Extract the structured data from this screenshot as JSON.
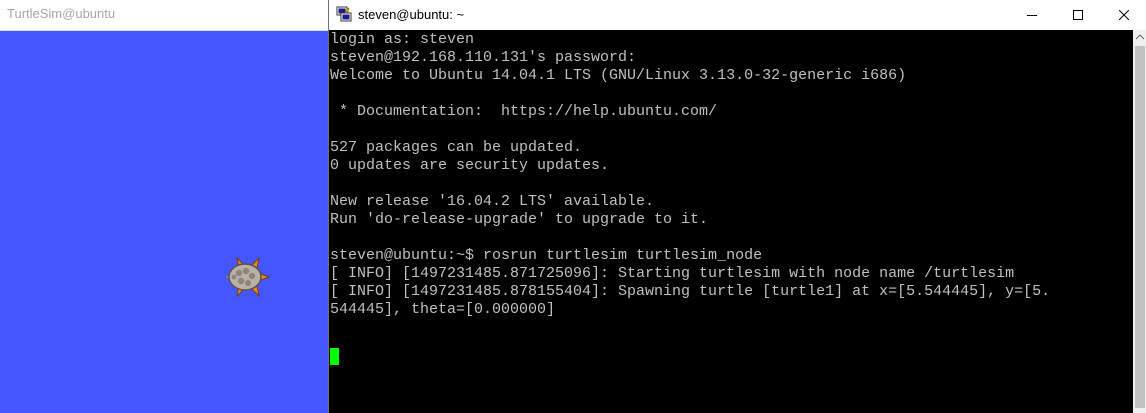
{
  "turtlesim": {
    "title": "TurtleSim@ubuntu",
    "background_color": "#4556ff"
  },
  "terminal": {
    "title": "steven@ubuntu: ~",
    "icons": {
      "app": "putty-icon",
      "minimize": "minimize-icon",
      "maximize": "maximize-icon",
      "close": "close-icon"
    },
    "lines": [
      "login as: steven",
      "steven@192.168.110.131's password:",
      "Welcome to Ubuntu 14.04.1 LTS (GNU/Linux 3.13.0-32-generic i686)",
      "",
      " * Documentation:  https://help.ubuntu.com/",
      "",
      "527 packages can be updated.",
      "0 updates are security updates.",
      "",
      "New release '16.04.2 LTS' available.",
      "Run 'do-release-upgrade' to upgrade to it.",
      "",
      "steven@ubuntu:~$ rosrun turtlesim turtlesim_node",
      "[ INFO] [1497231485.871725096]: Starting turtlesim with node name /turtlesim",
      "[ INFO] [1497231485.878155404]: Spawning turtle [turtle1] at x=[5.544445], y=[5.",
      "544445], theta=[0.000000]"
    ],
    "cursor_color": "#00ff00"
  }
}
